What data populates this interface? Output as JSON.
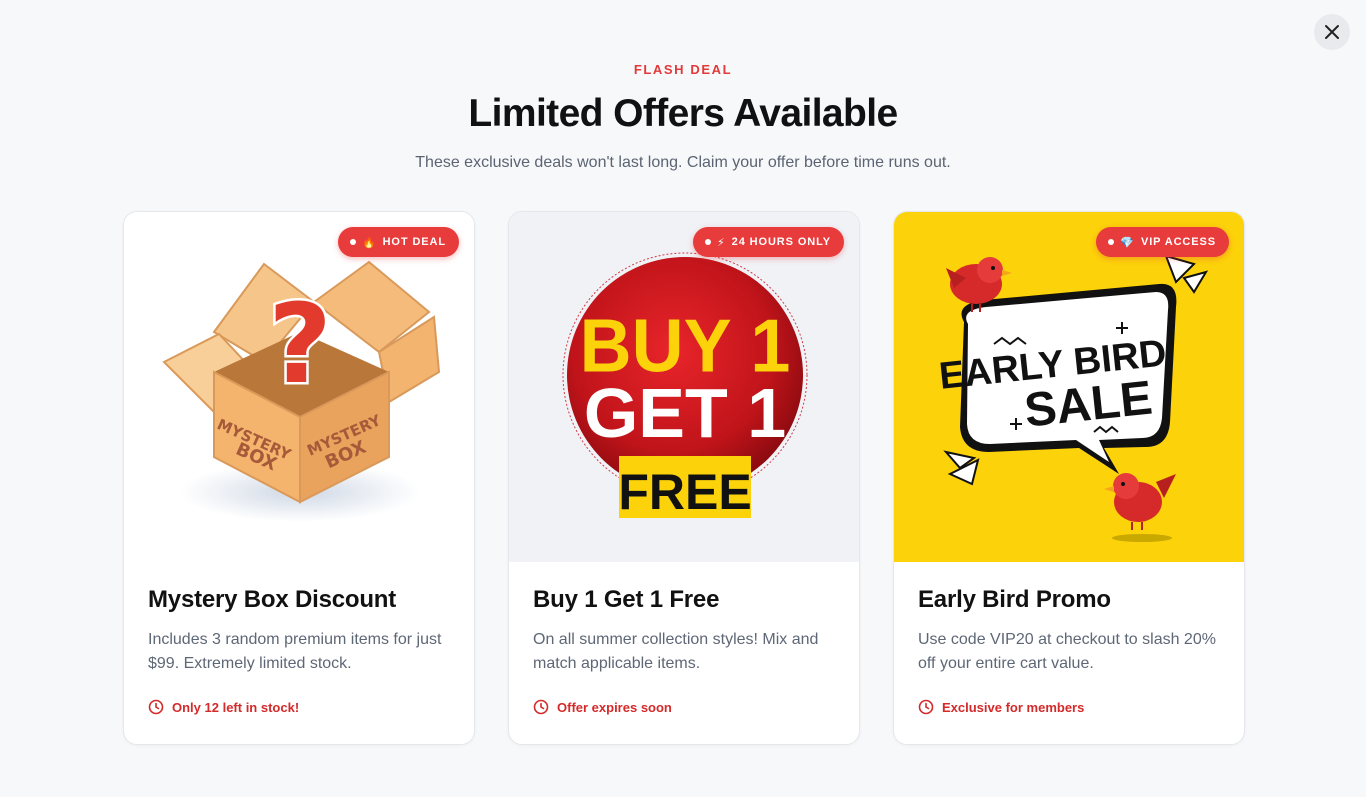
{
  "header": {
    "eyebrow": "FLASH DEAL",
    "title": "Limited Offers Available",
    "subtitle": "These exclusive deals won't last long. Claim your offer before time runs out."
  },
  "colors": {
    "accent": "#e83b3b",
    "note": "#d42a2a",
    "promo_yellow": "#fcd20a"
  },
  "cards": [
    {
      "badge_icon": "🔥",
      "badge": "HOT DEAL",
      "image_alt": "Mystery box",
      "image_text": [
        "MYSTERY",
        "BOX"
      ],
      "title": "Mystery Box Discount",
      "description": "Includes 3 random premium items for just $99. Extremely limited stock.",
      "note_icon": "clock-icon",
      "note": "Only 12 left in stock!"
    },
    {
      "badge_icon": "⚡",
      "badge": "24 HOURS ONLY",
      "image_alt": "Buy 1 Get 1 Free",
      "image_text": [
        "BUY 1",
        "GET 1",
        "FREE"
      ],
      "title": "Buy 1 Get 1 Free",
      "description": "On all summer collection styles! Mix and match applicable items.",
      "note_icon": "clock-icon",
      "note": "Offer expires soon"
    },
    {
      "badge_icon": "💎",
      "badge": "VIP ACCESS",
      "image_alt": "Early Bird Sale",
      "image_text": [
        "EARLY BIRD",
        "SALE"
      ],
      "title": "Early Bird Promo",
      "description": "Use code VIP20 at checkout to slash 20% off your entire cart value.",
      "note_icon": "clock-icon",
      "note": "Exclusive for members"
    }
  ]
}
